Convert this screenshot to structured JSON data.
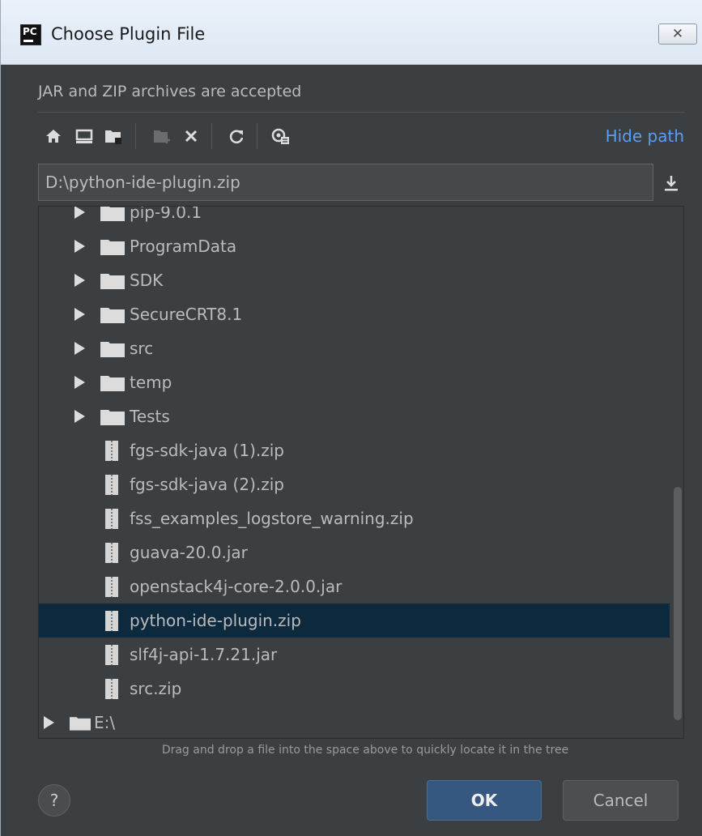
{
  "window": {
    "title": "Choose Plugin File",
    "app_icon_text": "PC",
    "close_symbol": "✕"
  },
  "header": {
    "subtitle": "JAR and ZIP archives are accepted"
  },
  "toolbar": {
    "icons": [
      "home-icon",
      "desktop-icon",
      "project-folder-icon",
      "new-folder-icon",
      "delete-icon",
      "refresh-icon",
      "show-hidden-icon"
    ],
    "hide_path_label": "Hide path"
  },
  "path": {
    "value": "D:\\python-ide-plugin.zip"
  },
  "tree": {
    "partial_top_label": "pip-9.0.1",
    "folders": [
      {
        "label": "ProgramData"
      },
      {
        "label": "SDK"
      },
      {
        "label": "SecureCRT8.1"
      },
      {
        "label": "src"
      },
      {
        "label": "temp"
      },
      {
        "label": "Tests"
      }
    ],
    "files": [
      {
        "label": "fgs-sdk-java (1).zip"
      },
      {
        "label": "fgs-sdk-java (2).zip"
      },
      {
        "label": "fss_examples_logstore_warning.zip"
      },
      {
        "label": "guava-20.0.jar"
      },
      {
        "label": "openstack4j-core-2.0.0.jar"
      },
      {
        "label": "python-ide-plugin.zip",
        "selected": true
      },
      {
        "label": "slf4j-api-1.7.21.jar"
      },
      {
        "label": "src.zip"
      }
    ],
    "drive": {
      "label": "E:\\"
    }
  },
  "hint": "Drag and drop a file into the space above to quickly locate it in the tree",
  "buttons": {
    "help": "?",
    "ok": "OK",
    "cancel": "Cancel"
  },
  "colors": {
    "background": "#3c3f41",
    "text": "#bbbbbb",
    "link": "#589df6",
    "selection": "#0d293e",
    "primary_button": "#365880"
  }
}
